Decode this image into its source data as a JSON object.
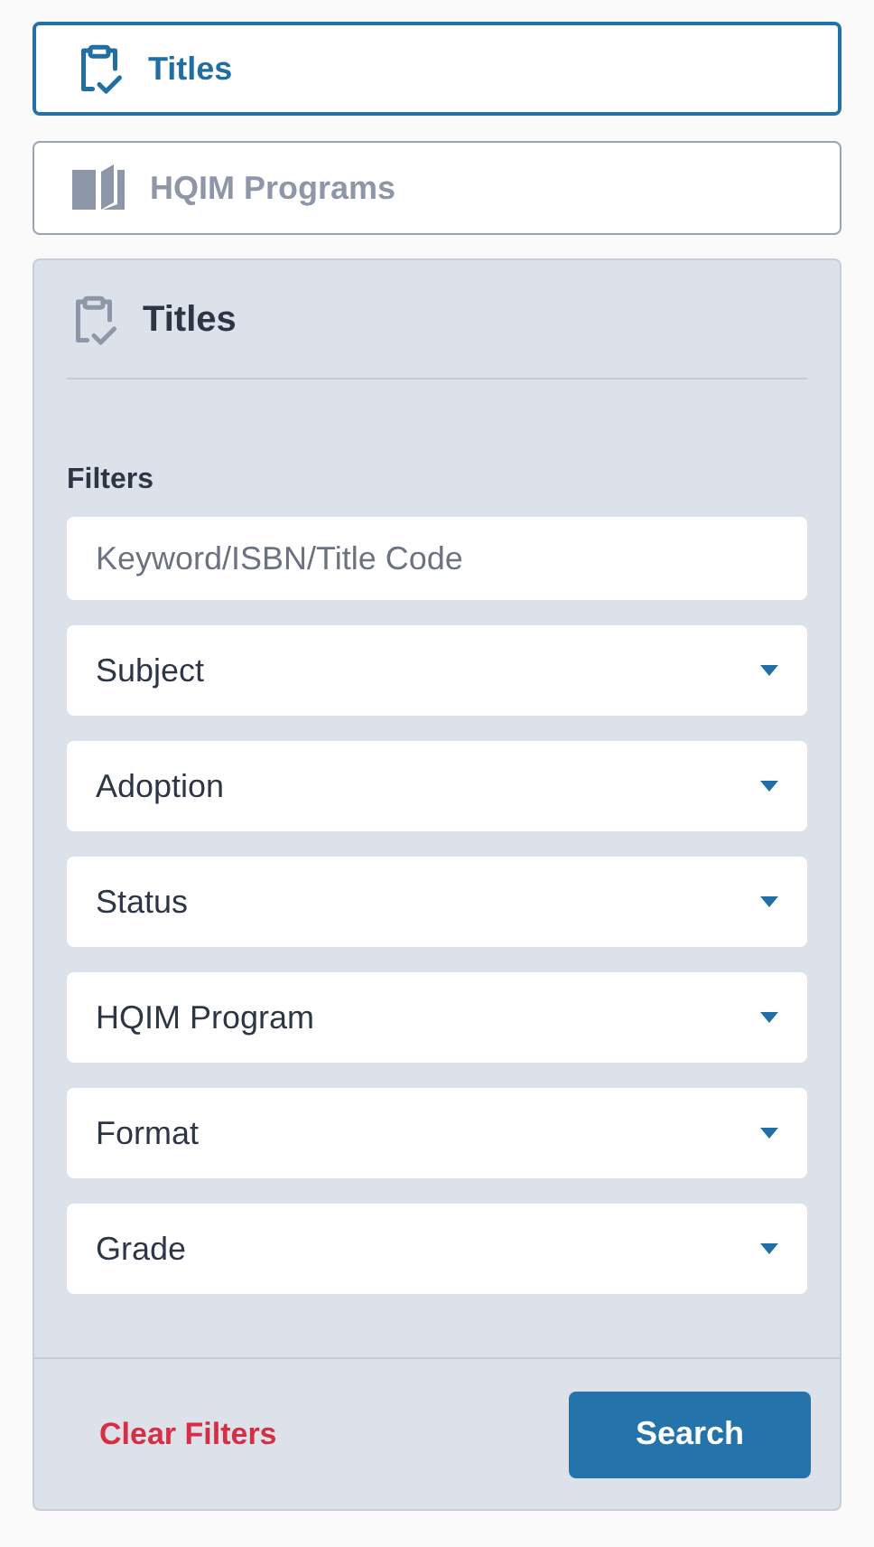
{
  "tabs": [
    {
      "label": "Titles",
      "kind": "clipboard",
      "selected": true
    },
    {
      "label": "HQIM Programs",
      "kind": "book",
      "selected": false
    }
  ],
  "panel": {
    "title": "Titles",
    "filters_label": "Filters",
    "search": {
      "placeholder": "Keyword/ISBN/Title Code"
    },
    "dropdowns": [
      "Subject",
      "Adoption",
      "Status",
      "HQIM Program",
      "Format",
      "Grade"
    ],
    "clear_button": "Clear Filters",
    "search_button": "Search"
  }
}
